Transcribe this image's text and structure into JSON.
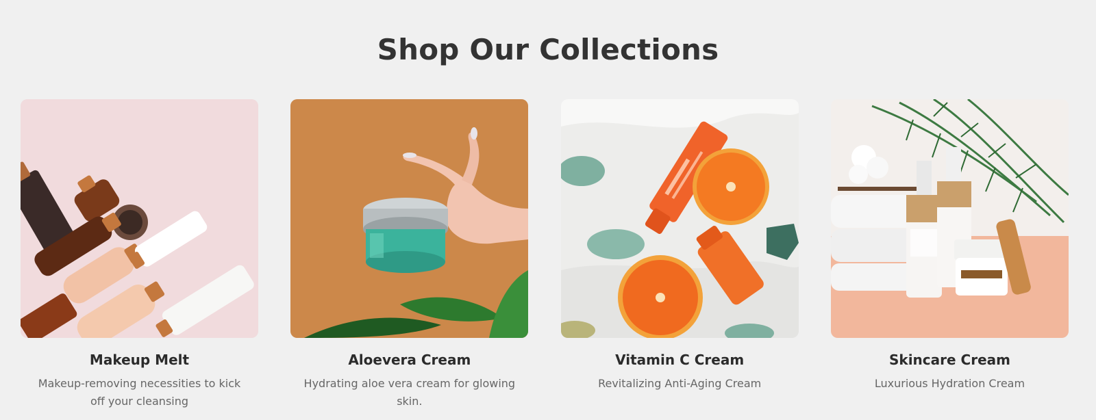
{
  "section": {
    "title": "Shop Our Collections"
  },
  "collections": [
    {
      "title": "Makeup Melt",
      "description": "Makeup-removing necessities to kick off your cleansing",
      "image": "makeup-products-flatlay",
      "accent": "#efd6d8"
    },
    {
      "title": "Aloevera Cream",
      "description": "Hydrating aloe vera cream for glowing skin.",
      "image": "hand-holding-aloe-jar",
      "accent": "#c98446"
    },
    {
      "title": "Vitamin C Cream",
      "description": "Revitalizing Anti-Aging Cream",
      "image": "vitamin-c-oranges",
      "accent": "#f0632a"
    },
    {
      "title": "Skincare Cream",
      "description": "Luxurious Hydration Cream",
      "image": "skincare-bottles-towels",
      "accent": "#f2b79c"
    }
  ]
}
